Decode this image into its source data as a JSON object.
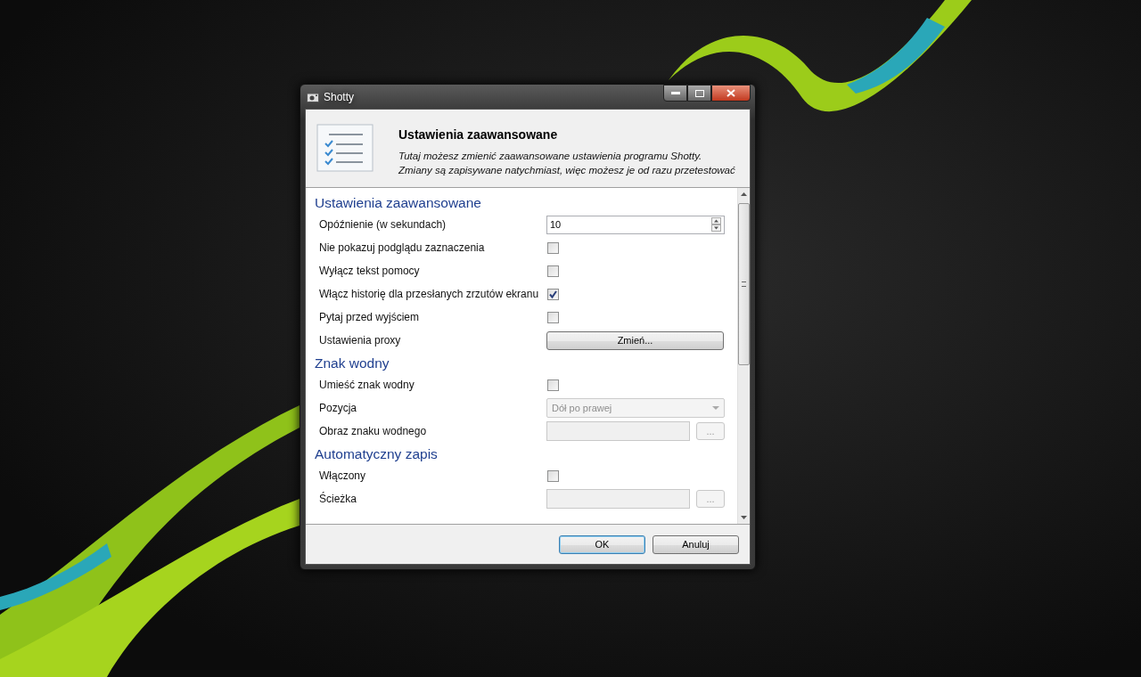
{
  "window": {
    "title": "Shotty"
  },
  "header": {
    "title": "Ustawienia zaawansowane",
    "description": "Tutaj możesz zmienić zaawansowane ustawienia programu Shotty.\nZmiany są zapisywane natychmiast, więc możesz je od razu przetestować"
  },
  "sections": [
    {
      "title": "Ustawienia zaawansowane",
      "rows": [
        {
          "kind": "number",
          "label": "Opóźnienie (w sekundach)",
          "value": "10"
        },
        {
          "kind": "checkbox",
          "label": "Nie pokazuj podglądu zaznaczenia",
          "checked": false
        },
        {
          "kind": "checkbox",
          "label": "Wyłącz tekst pomocy",
          "checked": false
        },
        {
          "kind": "checkbox",
          "label": "Włącz historię dla przesłanych zrzutów ekranu",
          "checked": true
        },
        {
          "kind": "checkbox",
          "label": "Pytaj przed wyjściem",
          "checked": false
        },
        {
          "kind": "button",
          "label": "Ustawienia proxy",
          "button": "Zmień..."
        }
      ]
    },
    {
      "title": "Znak wodny",
      "rows": [
        {
          "kind": "checkbox",
          "label": "Umieść znak wodny",
          "checked": false
        },
        {
          "kind": "dropdown",
          "label": "Pozycja",
          "value": "Dół po prawej",
          "disabled": true
        },
        {
          "kind": "path",
          "label": "Obraz znaku wodnego",
          "button": "...",
          "disabled": true
        }
      ]
    },
    {
      "title": "Automatyczny zapis",
      "rows": [
        {
          "kind": "checkbox",
          "label": "Włączony",
          "checked": false
        },
        {
          "kind": "path",
          "label": "Ścieżka",
          "button": "...",
          "disabled": true
        }
      ]
    }
  ],
  "buttons": [
    {
      "label": "OK",
      "default": true
    },
    {
      "label": "Anuluj",
      "default": false
    }
  ]
}
